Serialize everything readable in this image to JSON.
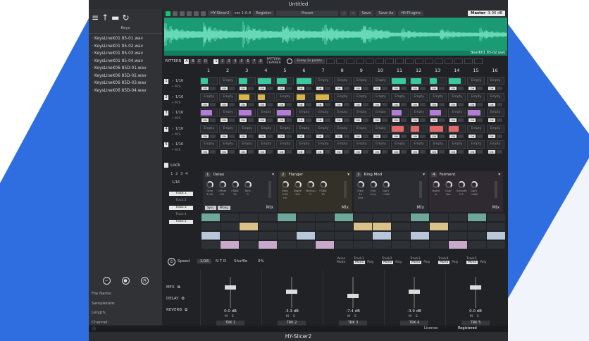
{
  "window": {
    "title": "Untitled",
    "bottom_title": "HY-Slicer2"
  },
  "sidebar": {
    "section": "Keys",
    "files": [
      "KeysLineK01 85-01.wav",
      "KeysLineK01 85-02.wav",
      "KeysLineK01 85-03.wav",
      "KeysLineK01 85-04.wav",
      "KeysLineK06 85D-01.wav",
      "KeysLineK06 85D-02.wav",
      "KeysLineK06 85D-03.wav",
      "KeysLineK06 85D-04.wav"
    ],
    "info": {
      "file_name": "File Name:",
      "samplerate": "Samplerate:",
      "length": "Length:",
      "channel": "Channel:"
    }
  },
  "toolbar": {
    "plugin": "HY-Slicer2",
    "version": "ver 1.0.4",
    "register": "Register",
    "preset": "Preset",
    "save": "Save",
    "save_as": "Save As",
    "plugins": "HY-Plugins",
    "master_label": "Master",
    "master_value": "-3.00 dB"
  },
  "waveform": {
    "filename": "BeatK01 85-02.wav",
    "color": "#1b9b73"
  },
  "pattern": {
    "label": "PATTERN",
    "letters": [
      "A",
      "B",
      "C",
      "D"
    ],
    "numbers": [
      "1",
      "2",
      "3",
      "4",
      "5",
      "6",
      "7",
      "8"
    ],
    "chainer": "PATTERN CHAINER",
    "every": "Every 1x pulses"
  },
  "steps": [
    "1",
    "2",
    "3",
    "4",
    "5",
    "6",
    "7",
    "8",
    "9",
    "10",
    "11",
    "12",
    "13",
    "14",
    "15",
    "16"
  ],
  "cell_labels": {
    "empty": "Empty",
    "on": "ON"
  },
  "tracks": [
    {
      "num": "1",
      "rate": "1/16",
      "color": "#38c9a0",
      "cells": [
        1,
        0,
        1,
        1,
        1,
        1,
        0,
        0,
        0,
        0,
        1,
        1,
        1,
        1,
        0,
        0
      ]
    },
    {
      "num": "2",
      "rate": "1/16",
      "color": "#d8b44a",
      "cells": [
        0,
        0,
        1,
        1,
        0,
        1,
        1,
        0,
        0,
        0,
        0,
        0,
        0,
        0,
        0,
        0
      ]
    },
    {
      "num": "3",
      "rate": "1/16",
      "color": "#b57bd9",
      "cells": [
        1,
        0,
        1,
        0,
        1,
        0,
        0,
        0,
        0,
        0,
        1,
        0,
        1,
        0,
        1,
        0
      ]
    },
    {
      "num": "4",
      "rate": "1/16",
      "color": "#e06a6a",
      "cells": [
        0,
        0,
        0,
        0,
        0,
        0,
        0,
        0,
        0,
        0,
        1,
        1,
        1,
        1,
        0,
        0
      ]
    },
    {
      "num": "5",
      "rate": "1/16",
      "color": "#5aa8e0",
      "cells": [
        0,
        0,
        0,
        0,
        0,
        0,
        0,
        0,
        0,
        0,
        0,
        0,
        0,
        0,
        0,
        0
      ]
    }
  ],
  "lock_label": "Lock",
  "fx_tabs": [
    "1",
    "2",
    "3",
    "4"
  ],
  "fx_tracks": [
    "Track 1",
    "Track 2",
    "Track 3",
    "Track 4",
    "Track 5"
  ],
  "fx": [
    {
      "num": "1",
      "name": "Delay",
      "color": "#2a2c31",
      "knobs": [
        [
          "Time",
          "1/16"
        ],
        [
          "Offset",
          "0%"
        ],
        [
          "FDBK",
          "35"
        ],
        [
          "Tone",
          "0"
        ]
      ],
      "switches": [
        "Sync",
        "PPong"
      ],
      "mix": "Mix"
    },
    {
      "num": "2",
      "name": "Flanger",
      "color": "#333028",
      "knobs": [
        [
          "Rate",
          "0.06 Hz"
        ],
        [
          "Depth",
          "100"
        ],
        [
          "Manual",
          "0"
        ],
        [
          "FDBK",
          "70"
        ]
      ],
      "switches": [],
      "mix": "Mix"
    },
    {
      "num": "3",
      "name": "Ring Mod",
      "color": "#2a2c31",
      "knobs": [
        [
          "Freq",
          "1k CHz"
        ],
        [
          "Fine",
          "Only"
        ],
        [
          "Gain",
          "+2dB"
        ]
      ],
      "switches": [],
      "mix": "Mix"
    },
    {
      "num": "4",
      "name": "Ferment",
      "color": "#2f2a31",
      "knobs": [
        [
          "Vowel",
          "A"
        ],
        [
          "Char",
          "Nor"
        ],
        [
          "Smooth",
          "2.3"
        ],
        [
          "Gain",
          "+6dB"
        ]
      ],
      "switches": [],
      "mix": "Mix"
    }
  ],
  "speed": {
    "label": "Speed",
    "value": "1/16",
    "ntd": [
      "N",
      "T",
      "D"
    ],
    "shuffle_label": "Shuffle",
    "shuffle_value": "0%",
    "voice_mode_label": "Voice Mode",
    "voices": [
      {
        "track": "Track1",
        "mono": "Mono",
        "poly": "Poly"
      },
      {
        "track": "Track2",
        "mono": "Mono",
        "poly": "Poly"
      },
      {
        "track": "Track3",
        "mono": "Mono",
        "poly": "Poly"
      },
      {
        "track": "Track4",
        "mono": "Mono",
        "poly": "Poly"
      },
      {
        "track": "Track5",
        "mono": "Mono",
        "poly": "Poly"
      }
    ]
  },
  "mixer": {
    "sends": [
      "MFX",
      "DELAY",
      "REVERB"
    ],
    "strips": [
      {
        "db": "0.0 dB",
        "name": "TRK 1",
        "level": 0.7
      },
      {
        "db": "-3.3 dB",
        "name": "TRK 2",
        "level": 0.55
      },
      {
        "db": "-7.4 dB",
        "name": "TRK 3",
        "level": 0.4
      },
      {
        "db": "-3.9 dB",
        "name": "TRK 4",
        "level": 0.55
      },
      {
        "db": "0.0 dB",
        "name": "TRK 5",
        "level": 0.7
      }
    ],
    "m_label": "M",
    "s_label": "S"
  },
  "status": {
    "license_label": "License:",
    "license_value": "Registered"
  }
}
